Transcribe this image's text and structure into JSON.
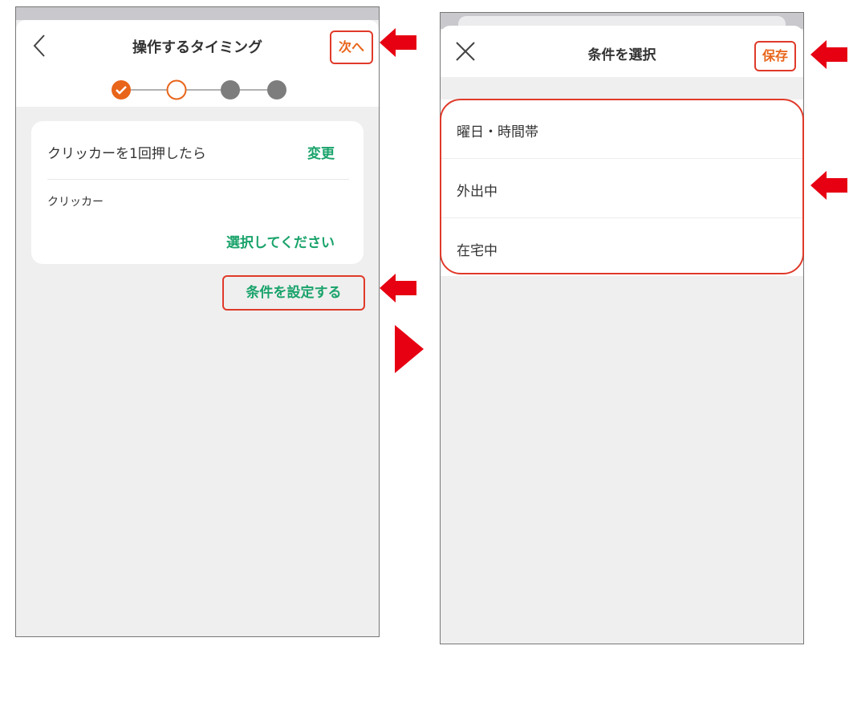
{
  "screen1": {
    "title": "操作するタイミング",
    "next_label": "次へ",
    "trigger_text": "クリッカーを1回押したら",
    "change_label": "変更",
    "device_label": "クリッカー",
    "select_label": "選択してください",
    "condition_button_label": "条件を設定する",
    "stepper": {
      "total_steps": 4,
      "current_step": 2,
      "completed_steps": 1
    }
  },
  "screen2": {
    "title": "条件を選択",
    "save_label": "保存",
    "options": [
      "曜日・時間帯",
      "外出中",
      "在宅中"
    ]
  },
  "colors": {
    "accent_orange": "#e8651a",
    "accent_green": "#1aa36b",
    "annotation_red": "#e60012",
    "step_inactive": "#7d7d7d"
  },
  "icons": [
    "back-chevron-icon",
    "close-x-icon",
    "check-icon",
    "red-arrow-left-icon",
    "red-play-arrow-icon"
  ]
}
